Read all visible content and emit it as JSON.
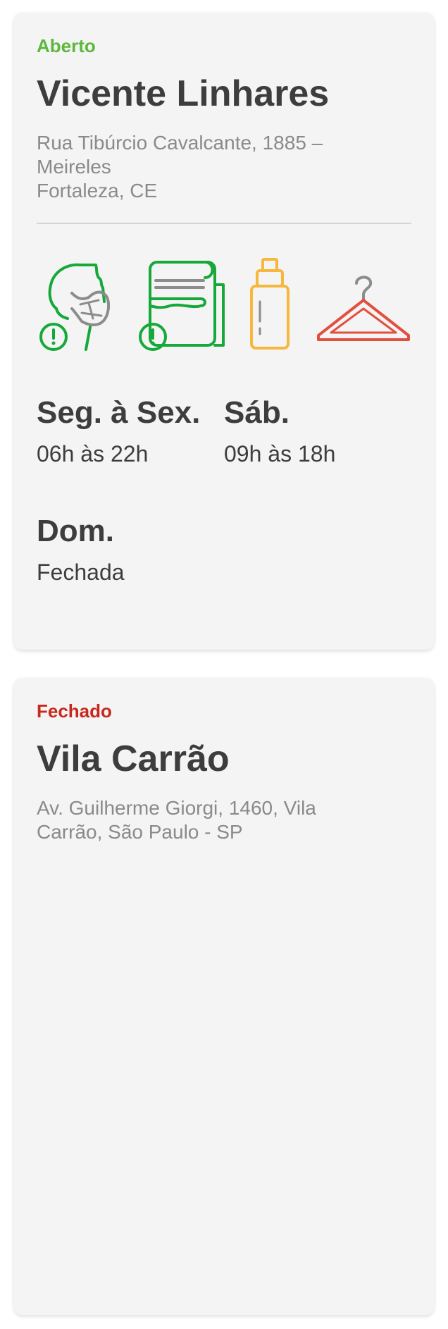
{
  "stores": [
    {
      "status": "Aberto",
      "name": "Vicente Linhares",
      "address_lines": [
        "Rua Tibúrcio Cavalcante, 1885 –",
        "Meireles",
        "Fortaleza, CE"
      ],
      "icons": [
        "face-mask-alert-icon",
        "paper-towel-alert-icon",
        "sanitizer-bottle-icon",
        "clothes-hanger-icon"
      ],
      "hours": [
        {
          "day": "Seg. à Sex.",
          "time": "06h às 22h"
        },
        {
          "day": "Sáb.",
          "time": "09h às 18h"
        },
        {
          "day": "Dom.",
          "time": "Fechada"
        }
      ]
    },
    {
      "status": "Fechado",
      "name": "Vila Carrão",
      "address_lines": [
        "Av. Guilherme Giorgi, 1460, Vila",
        "Carrão, São Paulo - SP"
      ]
    }
  ],
  "colors": {
    "open": "#5cb83d",
    "closed": "#c8281e",
    "text": "#3d3d3d",
    "muted": "#8a8a8a",
    "icon_green": "#17a83a",
    "icon_gray": "#8c8c8c",
    "icon_yellow": "#f6b73c",
    "icon_red": "#e2503d"
  }
}
